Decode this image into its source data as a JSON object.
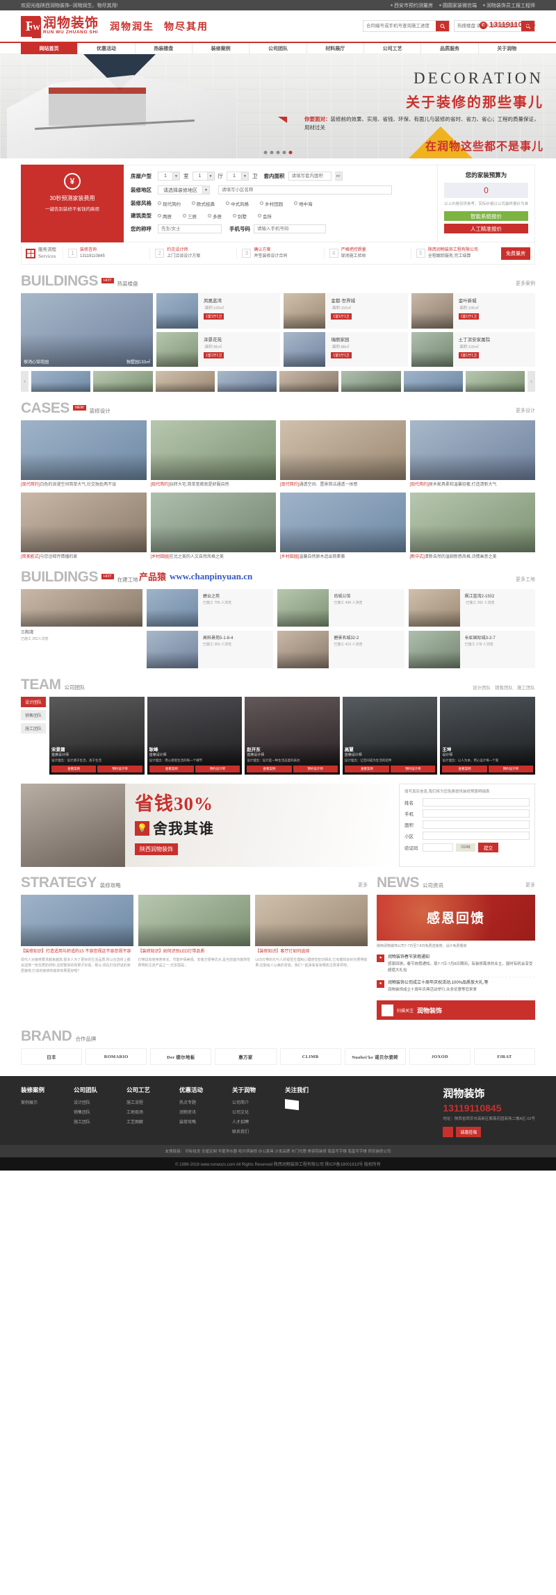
{
  "topbar": {
    "welcome": "欢迎光临陕西润物装饰--润物润生、物尽其用!",
    "links": [
      "西安市预约测量房",
      "圆圆家装微信端",
      "润物装饰员工报工程师"
    ]
  },
  "header": {
    "logo_cn": "润物装饰",
    "logo_en": "RUN WU ZHUANG SHI",
    "logo_letter": "R",
    "slogan1": "润物润生",
    "slogan2": "物尽其用",
    "search1_placeholder": "合同编号或手机号查询施工进度",
    "search2_placeholder": "热搜楼盘:请输入您的楼盘名称",
    "phone": "13119110845",
    "search_icon": "search-icon",
    "phone_icon": "phone-icon"
  },
  "nav": {
    "items": [
      {
        "label": "网站首页",
        "active": true
      },
      {
        "label": "优惠活动",
        "active": false
      },
      {
        "label": "热装楼盘",
        "active": false
      },
      {
        "label": "装修案例",
        "active": false
      },
      {
        "label": "公司团队",
        "active": false
      },
      {
        "label": "材料展厅",
        "active": false
      },
      {
        "label": "公司工艺",
        "active": false
      },
      {
        "label": "品质服务",
        "active": false
      },
      {
        "label": "关于润物",
        "active": false
      }
    ]
  },
  "banner": {
    "decoration": "DECORATION",
    "headline": "关于装修的那些事儿",
    "sub_label": "你要面对：",
    "sub_text": "装修前的效果、实用、省钱、环保、有面儿与装修的省时、省力、省心；工程的质量保证，用材过关",
    "headline2": "在润物这些都不是事儿",
    "dots": 5,
    "active_dot": 5
  },
  "quote": {
    "coin_symbol": "¥",
    "left_title": "30秒预测家装费用",
    "left_sub": "一键告别装修不省钱的麻烦",
    "rows": {
      "house_type_label": "房屋户型",
      "rooms": "1",
      "rooms_unit": "室",
      "halls": "1",
      "halls_unit": "厅",
      "baths": "1",
      "baths_unit": "卫",
      "area_label": "套内面积",
      "area_placeholder": "请填写套内面积",
      "area_unit": "m²",
      "region_label": "装修地区",
      "region_value": "请选择装修地区",
      "community_placeholder": "请填写小区名称",
      "style_label": "装修风格",
      "styles": [
        "现代简约",
        "欧式经典",
        "中式风格",
        "乡村田园",
        "地中海"
      ],
      "building_label": "建筑类型",
      "buildings": [
        "两居",
        "三居",
        "多居",
        "别墅",
        "会所"
      ],
      "name_label": "您的称呼",
      "name_placeholder": "先生/女士",
      "phone_label": "手机号码",
      "phone_placeholder": "请输入手机号码"
    },
    "right": {
      "title": "您的家装预算为",
      "amount": "0",
      "note": "以上价格仅供参考，实际价格以公司最终报价为准",
      "btn_auto": "智能系统报价",
      "btn_manual": "人工精准报价"
    }
  },
  "steps": {
    "first_cn": "服务流程",
    "first_en": "Services",
    "items": [
      {
        "n": "1",
        "t1": "装修咨询",
        "t2": "13119110845"
      },
      {
        "n": "2",
        "t1": "约见设计师",
        "t2": "上门洽谈设计方案"
      },
      {
        "n": "3",
        "t1": "确认方案",
        "t2": "并签装修设计合同"
      },
      {
        "n": "4",
        "t1": "严格把控质量",
        "t2": "现场施工验收"
      },
      {
        "n": "5",
        "t1": "陕西润物装饰工程有限公司",
        "t2": "全程跟踪服务,完工结算"
      }
    ],
    "button": "免费量房"
  },
  "buildings": {
    "en": "BUILDINGS",
    "hot": "HOT",
    "cn": "热装楼盘",
    "more": "更多案例",
    "main": {
      "title": "探鸿心馆花园",
      "meta": "独墅园133㎡"
    },
    "cells": [
      {
        "title": "凤凰蓝湾",
        "sub": "·面积:120㎡",
        "badge": "1室1厅1卫"
      },
      {
        "title": "泽景花苑",
        "sub": "·面积:96㎡",
        "badge": "1室1厅1卫"
      },
      {
        "title": "金都·世界城",
        "sub": "·面积:110㎡",
        "badge": "1室1厅1卫"
      },
      {
        "title": "瑞丽家园",
        "sub": "·面积:88㎡",
        "badge": "1室1厅1卫"
      },
      {
        "title": "金叶新城",
        "sub": "·面积:100㎡",
        "badge": "1室1厅1卫"
      },
      {
        "title": "土丁滨安家属院",
        "sub": "·面积:133㎡",
        "badge": "1室1厅1卫"
      }
    ],
    "prev": "‹",
    "next": "›"
  },
  "cases": {
    "en": "CASES",
    "hot": "NEW",
    "cn": "装修设计",
    "more": "更多设计",
    "items": [
      {
        "tag": "[现代简约]",
        "text": "白色的浪漫空间简单大气,社交独处两不误"
      },
      {
        "tag": "[现代简约]",
        "text": "玩转大宅,简单宽敞就是舒服自然"
      },
      {
        "tag": "[现代简约]",
        "text": "通透空间、置景简洁通透一体感"
      },
      {
        "tag": "[现代简约]",
        "text": "原木家具柔和温馨轻奢,打造清新大气"
      },
      {
        "tag": "[简美欧式]",
        "text": "与您诠释传情播的家"
      },
      {
        "tag": "[乡村田园]",
        "text": "在北之美的人文自然风格之美"
      },
      {
        "tag": "[乡村田园]",
        "text": "温馨自然原木造出简素雅"
      },
      {
        "tag": "[新中式]",
        "text": "清新自然的温婉新感风格,诗情画意之美"
      }
    ]
  },
  "sites": {
    "en": "BUILDINGS",
    "hot": "HOT",
    "cn": "在建工地",
    "more": "更多工地",
    "watermark_cn": "产品猿",
    "watermark_url": "www.chanpinyuan.cn",
    "main": {
      "title": "三和湾",
      "meta": "已施工 282人浏览"
    },
    "items": [
      {
        "title": "碧云之苑",
        "l1": "已施工 795 人浏览",
        "l2": ""
      },
      {
        "title": "尚城公馆",
        "l1": "已施工 438 人浏览",
        "l2": ""
      },
      {
        "title": "枫江蓝湾2-1502",
        "l1": "·已施工 202 人浏览",
        "l2": ""
      },
      {
        "title": "高科景苑5-1-8-4",
        "l1": "已施工 350 人浏览",
        "l2": ""
      },
      {
        "title": "碧景名城32-2",
        "l1": "已施工 413 人浏览",
        "l2": ""
      },
      {
        "title": "长虹国际城3-2-7",
        "l1": "已施工 178 人浏览",
        "l2": ""
      }
    ]
  },
  "team": {
    "en": "TEAM",
    "cn": "公司团队",
    "tabs": [
      "设计团队",
      "销售团队",
      "施工团队"
    ],
    "side": [
      "设计团队",
      "销售团队",
      "施工团队"
    ],
    "members": [
      {
        "name": "宋景霜",
        "role": "首席设计师",
        "desc": "设计理念：设计源于生活，高于生活"
      },
      {
        "name": "耿峰",
        "role": "首席设计师",
        "desc": "设计理念：用心感受生活的每一个细节"
      },
      {
        "name": "赵开东",
        "role": "首席设计师",
        "desc": "设计理念：设计是一种生活态度的表达"
      },
      {
        "name": "高慧",
        "role": "首席设计师",
        "desc": "设计理念：让空间成为生活的延伸"
      },
      {
        "name": "王坤",
        "role": "设计师",
        "desc": "设计理念：以人为本，用心设计每一个家"
      }
    ],
    "btn1": "查看案例",
    "btn2": "预约设计师"
  },
  "promo": {
    "percent": "省钱30%",
    "word": "舍我其谁",
    "icon": "lamp-icon",
    "brand": "陕西润物装饰",
    "form": {
      "note": "填写真实信息,我们将为您免费提供装修预算明细表",
      "name_label": "姓名",
      "phone_label": "手机",
      "area_label": "面积",
      "community_label": "小区",
      "code_label": "验证码",
      "code_value": "0246",
      "submit": "提交"
    }
  },
  "strategy": {
    "en": "STRATEGY",
    "cn": "装修攻略",
    "more": "更多",
    "items": [
      {
        "title": "【装修知识】打造适用与舒适的15 不容忽视这不容忽视不容",
        "desc": "现代人对装修要求越来越高,很多人为了更好的生活品质,所以在选材上都会选择一些优质的材料,这样整体的效果才好看。那么,现在打造舒适的家居装修,打造的装修的装饰效果更好呢?"
      },
      {
        "title": "【装修知识】如何识别LED灯带品质",
        "desc": "灯带具有使用寿命长、节能环保美观、安装方便等优点,是当前室内装饰性照明的主流产品之一,光氛围是..."
      },
      {
        "title": "【装修知识】客厅灯如何选择",
        "desc": "LED灯带的光与人的视觉生理和心理感觉密切相关,它有着较好的光照明效果,还能给人以美的享受。我们一起来看看有哪些注意事项吧。"
      }
    ]
  },
  "news": {
    "en": "NEWS",
    "cn": "公司资讯",
    "more": "更多",
    "banner": "感恩回馈",
    "banner_sub": "陕西润物装饰公司7-7日至7-8日免费送装修，设计免费量房",
    "items": [
      {
        "title": "润物装饰春节放假通知",
        "desc": "感恩回馈，春节放假通知，现7-7日-7月8日期间，有装修需求的业主，届时有机会享受超值大礼包"
      },
      {
        "title": "润物装饰公司成立十周年庆祝活动,100%品质放大礼,等",
        "desc": "润物装饰成立十周年庆典活动举行,众多优惠等您来拿"
      }
    ],
    "qr_label": "扫描关注",
    "qr_brand": "润物装饰"
  },
  "brand": {
    "en": "BRAND",
    "cn": "合作品牌",
    "items": [
      "日丰",
      "ROMARIO",
      "Der 德尔地板",
      "惠万家",
      "CLIMB",
      "Nuobei'ke 诺贝尔瓷砖",
      "JOXOD",
      "FIRAT"
    ]
  },
  "footer": {
    "cols": [
      {
        "title": "装修案例",
        "links": [
          "案例展示"
        ]
      },
      {
        "title": "公司团队",
        "links": [
          "设计团队",
          "销售团队",
          "施工团队"
        ]
      },
      {
        "title": "公司工艺",
        "links": [
          "施工流程",
          "工地现场",
          "工艺图解"
        ]
      },
      {
        "title": "优惠活动",
        "links": [
          "热点专题",
          "润物资讯",
          "装修攻略"
        ]
      },
      {
        "title": "关于润物",
        "links": [
          "公司简介",
          "公司文化",
          "人才招聘",
          "联系我们"
        ]
      },
      {
        "title": "关注我们",
        "links": []
      }
    ],
    "company": "润物装饰",
    "tel": "13119110845",
    "address": "地址：陕西省西安市高新区紫薇花园商场二楼A区-02号",
    "btn_label": "诚邀莅临",
    "friend_label": "友情链接：",
    "friend_links": [
      "印标批发",
      "全屋定制",
      "华夏净水器",
      "哈尔滨装修",
      "办公家具",
      "沙发品牌",
      "木门代理",
      "美容院装修",
      "南昌写字楼",
      "南昌写字楼",
      "西安装修公司"
    ],
    "copyright": "© 1999-2018 www.runwuzs.com All Rights Reserved 陕西润物装饰工程有限公司 陕ICP备18001913号 版权所有"
  }
}
